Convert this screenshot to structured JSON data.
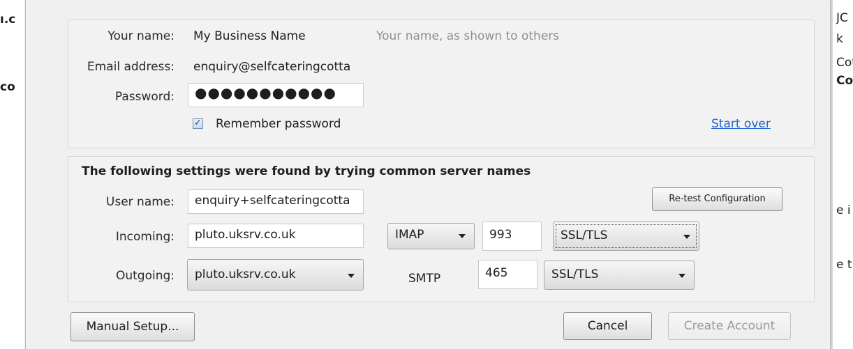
{
  "background_fragments": {
    "left": [
      "ı.c",
      "co"
    ],
    "right": [
      "JC",
      "k",
      "Cot",
      "Cot",
      "e i",
      "e t"
    ]
  },
  "identity": {
    "your_name_label": "Your name:",
    "your_name_value": "My Business Name",
    "your_name_hint": "Your name, as shown to others",
    "email_label": "Email address:",
    "email_value": "enquiry@selfcateringcotta",
    "password_label": "Password:",
    "password_value": "●●●●●●●●●●●",
    "remember_checked": "✓",
    "remember_label": "Remember password",
    "start_over": "Start over"
  },
  "settings": {
    "title": "The following settings were found by trying common server names",
    "username_label": "User name:",
    "username_value": "enquiry+selfcateringcotta",
    "retest_button": "Re-test Configuration",
    "incoming_label": "Incoming:",
    "incoming_host": "pluto.uksrv.co.uk",
    "incoming_protocol": "IMAP",
    "incoming_port": "993",
    "incoming_security": "SSL/TLS",
    "outgoing_label": "Outgoing:",
    "outgoing_host": "pluto.uksrv.co.uk",
    "outgoing_protocol": "SMTP",
    "outgoing_port": "465",
    "outgoing_security": "SSL/TLS"
  },
  "footer": {
    "manual_setup": "Manual Setup...",
    "cancel": "Cancel",
    "create_account": "Create Account"
  }
}
